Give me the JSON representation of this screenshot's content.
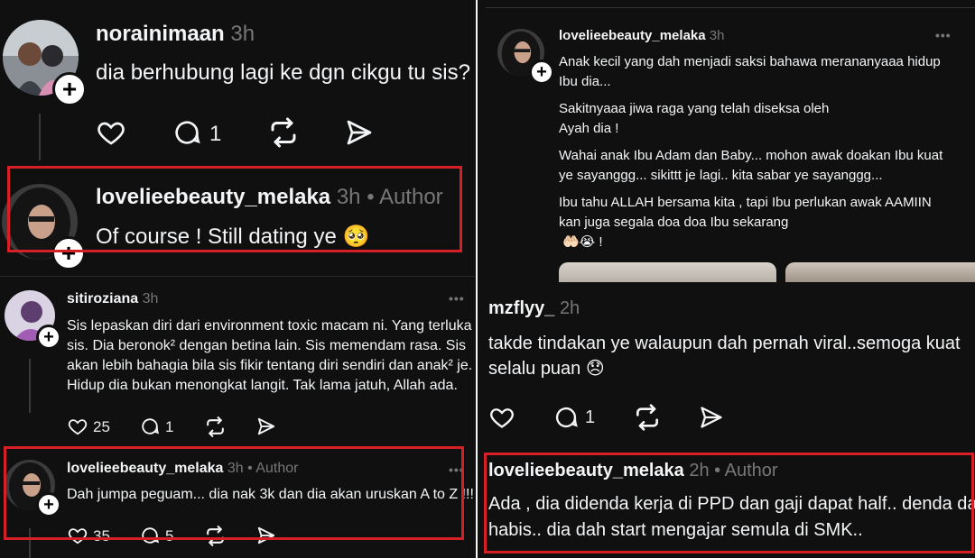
{
  "left": {
    "post1": {
      "username": "norainimaan",
      "time": "3h",
      "text": "dia berhubung lagi ke dgn cikgu tu sis?",
      "reply_count": "1"
    },
    "post2": {
      "username": "lovelieebeauty_melaka",
      "time": "3h",
      "author": "• Author",
      "text": "Of course ! Still dating ye 🥺"
    },
    "post3": {
      "username": "sitiroziana",
      "time": "3h",
      "lines": [
        "Sis lepaskan diri dari environment toxic macam ni. Yang terluka",
        "sis. Dia beronok² dengan betina lain. Sis memendam rasa. Sis",
        "akan lebih bahagia bila sis fikir tentang diri sendiri dan anak² je.",
        "Hidup dia bukan menongkat langit. Tak lama jatuh, Allah ada."
      ],
      "like_count": "25",
      "reply_count": "1"
    },
    "post4": {
      "username": "lovelieebeauty_melaka",
      "time": "3h",
      "author": "• Author",
      "text": "Dah jumpa peguam... dia nak 3k dan dia akan uruskan A to Z !!!",
      "like_count": "35",
      "reply_count": "5"
    }
  },
  "right": {
    "post1": {
      "username": "lovelieebeauty_melaka",
      "time": "3h",
      "lines": [
        "Anak kecil yang dah menjadi saksi bahawa merananyaaa hidup",
        "Ibu dia...",
        "Sakitnyaaa jiwa raga yang telah diseksa oleh",
        "Ayah dia !",
        "Wahai anak Ibu Adam dan Baby... mohon awak doakan Ibu kuat",
        "ye sayanggg... sikittt je lagi.. kita sabar ye sayanggg...",
        "Ibu tahu ALLAH bersama kita , tapi Ibu perlukan awak AAMIIN",
        "kan juga segala doa doa Ibu sekarang",
        "🤲🏻😭 !"
      ]
    },
    "post2": {
      "username": "mzflyy_",
      "time": "2h",
      "lines": [
        "takde tindakan ye walaupun dah pernah viral..semoga kuat",
        "selalu puan 😞"
      ],
      "reply_count": "1"
    },
    "post3": {
      "username": "lovelieebeauty_melaka",
      "time": "2h",
      "author": "• Author",
      "lines": [
        "Ada , dia didenda kerja di PPD dan gaji dapat half.. denda dah",
        "habis.. dia dah start mengajar semula di SMK.."
      ]
    }
  },
  "more_label": "•••",
  "icons": {
    "like": "heart-icon",
    "reply": "comment-icon",
    "repost": "repost-icon",
    "share": "send-icon",
    "follow": "plus-icon"
  },
  "colors": {
    "background": "#101010",
    "text": "#f3f5f7",
    "muted": "#777777",
    "highlight": "#d61f26"
  }
}
